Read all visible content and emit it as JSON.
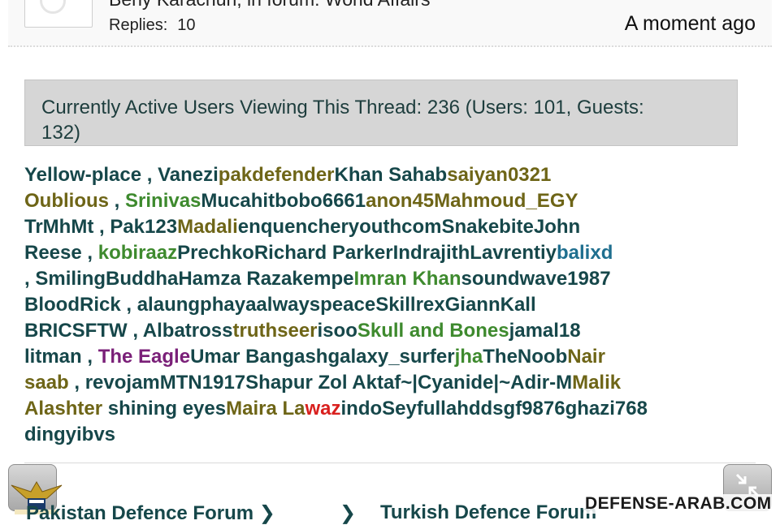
{
  "post": {
    "author_line": "Beny Karachun, in forum: World Affairs",
    "replies_label": "Replies:",
    "replies_count": "10",
    "time": "A moment ago"
  },
  "active": {
    "line1": "Currently Active Users Viewing This Thread: 236 (Users: 101, Guests:",
    "line2": "132)"
  },
  "users_lines": [
    [
      [
        "Yellow-place",
        "teal"
      ],
      [
        " , ",
        "sep"
      ],
      [
        "Vanezi",
        "teal"
      ],
      [
        "pakdefender",
        "olive"
      ],
      [
        "Khan Sahab",
        "teal"
      ],
      [
        "saiyan0321",
        "olive"
      ]
    ],
    [
      [
        "Oublious",
        "olive"
      ],
      [
        " , ",
        "sep"
      ],
      [
        "Srinivas",
        "green"
      ],
      [
        "Mucahitbobo6661",
        "teal"
      ],
      [
        "anon45",
        "olive"
      ],
      [
        "Mahmoud_EGY",
        "olive"
      ]
    ],
    [
      [
        "TrMhMt",
        "teal"
      ],
      [
        " , ",
        "sep"
      ],
      [
        "Pak123",
        "teal"
      ],
      [
        "Madali",
        "olive"
      ],
      [
        "enquencheryouthcom",
        "teal"
      ],
      [
        "Snakebite",
        "teal"
      ],
      [
        "John",
        "teal"
      ]
    ],
    [
      [
        "Reese",
        "teal"
      ],
      [
        " , ",
        "sep"
      ],
      [
        "kobiraaz",
        "green"
      ],
      [
        "Prechko",
        "teal"
      ],
      [
        "Richard Parker",
        "teal"
      ],
      [
        "Indrajith",
        "teal"
      ],
      [
        "Lavrentiy",
        "teal"
      ],
      [
        "balixd",
        "blue"
      ]
    ],
    [
      [
        " , ",
        "sep"
      ],
      [
        "SmilingBuddha",
        "teal"
      ],
      [
        "Hamza Razakempe",
        "teal"
      ],
      [
        "Imran Khan",
        "green"
      ],
      [
        "soundwave1987",
        "teal"
      ]
    ],
    [
      [
        "BloodRick",
        "teal"
      ],
      [
        " , ",
        "sep"
      ],
      [
        "alaungphaya",
        "teal"
      ],
      [
        "alwayspeace",
        "teal"
      ],
      [
        "Skillrex",
        "teal"
      ],
      [
        "GiannKall",
        "teal"
      ]
    ],
    [
      [
        "BRICSFTW",
        "teal"
      ],
      [
        " , ",
        "sep"
      ],
      [
        "Albatross",
        "teal"
      ],
      [
        "truthseer",
        "olive"
      ],
      [
        "isoo",
        "teal"
      ],
      [
        "Skull and Bones",
        "green"
      ],
      [
        "jamal18",
        "teal"
      ]
    ],
    [
      [
        "litman",
        "teal"
      ],
      [
        " , ",
        "sep"
      ],
      [
        "The Eagle",
        "purple"
      ],
      [
        "Umar Bangash",
        "teal"
      ],
      [
        "galaxy_surfer",
        "teal"
      ],
      [
        "jha",
        "green"
      ],
      [
        "TheNoob",
        "teal"
      ],
      [
        "Nair",
        "olive"
      ]
    ],
    [
      [
        "saab",
        "olive"
      ],
      [
        " , ",
        "sep"
      ],
      [
        "revojam",
        "teal"
      ],
      [
        "MTN1917",
        "teal"
      ],
      [
        "Shapur Zol Aktaf",
        "teal"
      ],
      [
        "~|Cyanide|~",
        "teal"
      ],
      [
        "Adir-M",
        "teal"
      ],
      [
        "Malik",
        "olive"
      ]
    ],
    [
      [
        "Alashter",
        "olive"
      ],
      [
        " shining eyes",
        "teal"
      ],
      [
        "Maira La",
        "olive"
      ],
      [
        "waz",
        "red"
      ],
      [
        "indo",
        "teal"
      ],
      [
        "Seyfullah",
        "teal"
      ],
      [
        "ddsgf9876",
        "teal"
      ],
      [
        "ghazi768",
        "teal"
      ]
    ],
    [
      [
        "dingyibvs",
        "teal"
      ]
    ]
  ],
  "breadcrumbs": [
    "Pakistan Defence Forum",
    "Turkish Defence Forum"
  ],
  "watermark": "DEFENSE-ARAB.COM",
  "colors": {
    "teal": "#16474a",
    "olive": "#6e6517",
    "green": "#3e8a2e",
    "blue": "#1f6f8f",
    "purple": "#7a1f78",
    "red": "#d9201e"
  },
  "icons": {
    "left_button": "logo-eagle-icon",
    "right_button": "collapse-arrows-icon",
    "breadcrumb_separator": "chevron-right-icon"
  }
}
